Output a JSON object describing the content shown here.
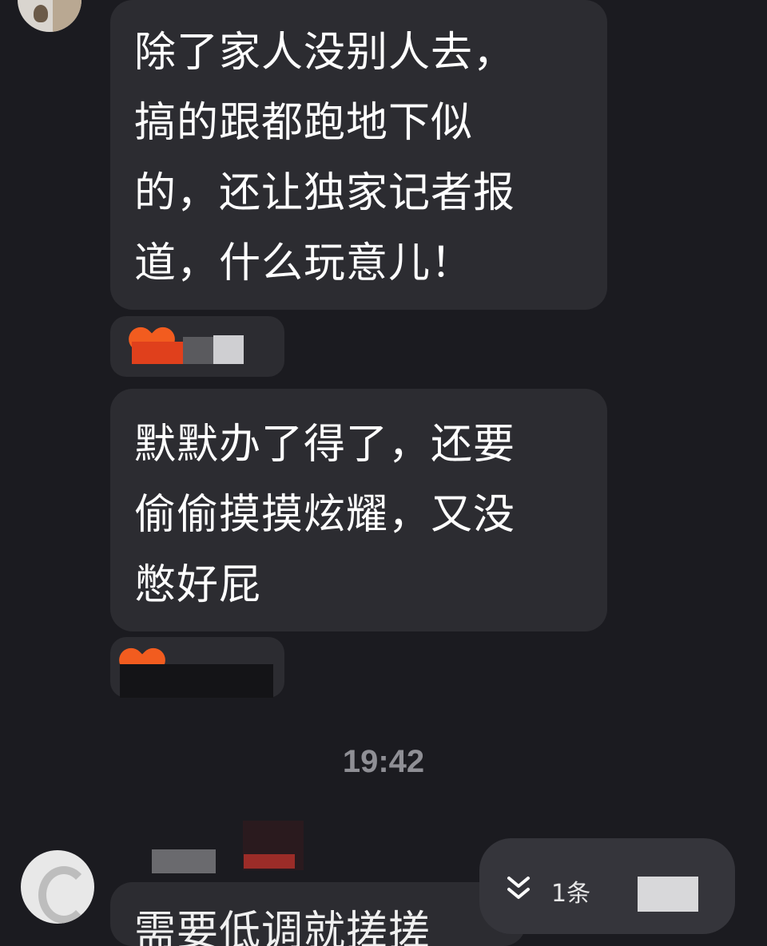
{
  "messages": [
    {
      "text": "除了家人没别人去，\n搞的跟都跑地下似\n的，还让独家记者报\n道，什么玩意儿！"
    },
    {
      "text": "默默办了得了，还要\n偷偷摸摸炫耀，又没\n憋好屁"
    },
    {
      "text": "需要低调就搓搓"
    }
  ],
  "timestamp": "19:42",
  "new_messages_pill": {
    "icon": "chevron-double-down",
    "label": "1条"
  },
  "colors": {
    "background": "#1b1b20",
    "bubble": "#2c2c31",
    "heart": "#f25c1f",
    "timestamp": "#8f8f95"
  }
}
